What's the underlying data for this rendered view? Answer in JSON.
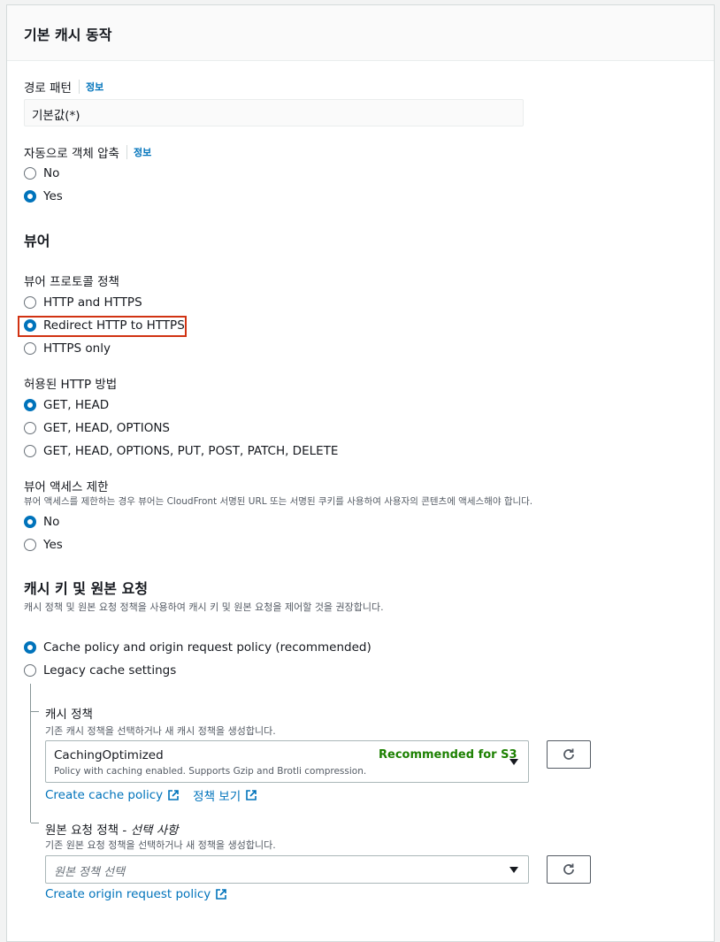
{
  "section_title": "기본 캐시 동작",
  "path_pattern": {
    "label": "경로 패턴",
    "info": "정보",
    "value": "기본값(*)"
  },
  "compress": {
    "label": "자동으로 객체 압축",
    "info": "정보",
    "options": [
      "No",
      "Yes"
    ],
    "selected": "Yes"
  },
  "viewer": {
    "heading": "뷰어",
    "protocol": {
      "label": "뷰어 프로토콜 정책",
      "options": [
        "HTTP and HTTPS",
        "Redirect HTTP to HTTPS",
        "HTTPS only"
      ],
      "selected": "Redirect HTTP to HTTPS",
      "highlighted": "Redirect HTTP to HTTPS"
    },
    "methods": {
      "label": "허용된 HTTP 방법",
      "options": [
        "GET, HEAD",
        "GET, HEAD, OPTIONS",
        "GET, HEAD, OPTIONS, PUT, POST, PATCH, DELETE"
      ],
      "selected": "GET, HEAD"
    },
    "restrict": {
      "label": "뷰어 액세스 제한",
      "description": "뷰어 액세스를 제한하는 경우 뷰어는 CloudFront 서명된 URL 또는 서명된 쿠키를 사용하여 사용자의 콘텐츠에 액세스해야 합니다.",
      "options": [
        "No",
        "Yes"
      ],
      "selected": "No"
    }
  },
  "cache_key": {
    "heading": "캐시 키 및 원본 요청",
    "description": "캐시 정책 및 원본 요청 정책을 사용하여 캐시 키 및 원본 요청을 제어할 것을 권장합니다.",
    "options": [
      "Cache policy and origin request policy (recommended)",
      "Legacy cache settings"
    ],
    "selected": "Cache policy and origin request policy (recommended)",
    "cache_policy": {
      "label": "캐시 정책",
      "description": "기존 캐시 정책을 선택하거나 새 캐시 정책을 생성합니다.",
      "selected_name": "CachingOptimized",
      "badge": "Recommended for S3",
      "selected_desc": "Policy with caching enabled. Supports Gzip and Brotli compression.",
      "create_link": "Create cache policy",
      "view_link": "정책 보기"
    },
    "origin_policy": {
      "label": "원본 요청 정책 - ",
      "label_optional": "선택 사항",
      "description": "기존 원본 요청 정책을 선택하거나 새 정책을 생성합니다.",
      "placeholder": "원본 정책 선택",
      "create_link": "Create origin request policy"
    }
  },
  "colors": {
    "accent": "#0073bb",
    "badge": "#1d8102",
    "highlight": "#d13212"
  }
}
